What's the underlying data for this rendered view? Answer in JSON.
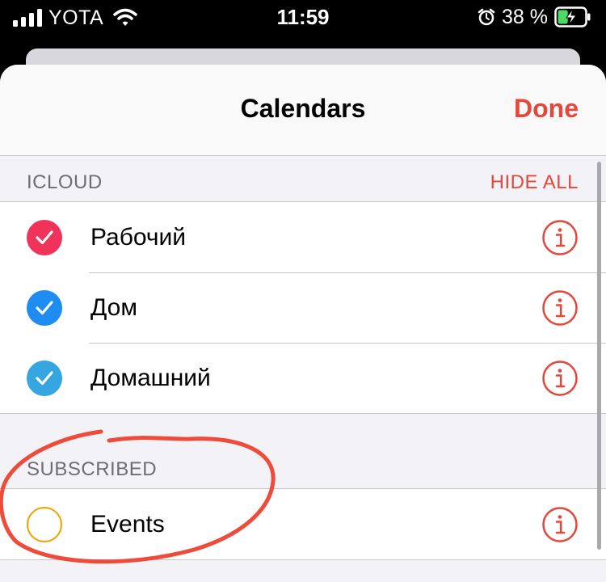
{
  "status_bar": {
    "carrier": "YOTA",
    "time": "11:59",
    "battery_percent": "38 %",
    "battery_level": 0.38
  },
  "nav": {
    "title": "Calendars",
    "done_label": "Done"
  },
  "sections": {
    "icloud": {
      "title": "ICLOUD",
      "action": "HIDE ALL",
      "items": [
        {
          "label": "Рабочий",
          "checked": true,
          "color": "#f0335b"
        },
        {
          "label": "Дом",
          "checked": true,
          "color": "#1e8cf0"
        },
        {
          "label": "Домашний",
          "checked": true,
          "color": "#35a6e0"
        }
      ]
    },
    "subscribed": {
      "title": "SUBSCRIBED",
      "items": [
        {
          "label": "Events",
          "checked": false,
          "color": "#f2a100"
        }
      ]
    }
  },
  "colors": {
    "accent": "#e5473b",
    "separator": "#c6c6c8",
    "annotation": "#ee4b3a"
  },
  "icons": {
    "row_action": "info-circle-icon",
    "checked": "checkmark-icon"
  }
}
